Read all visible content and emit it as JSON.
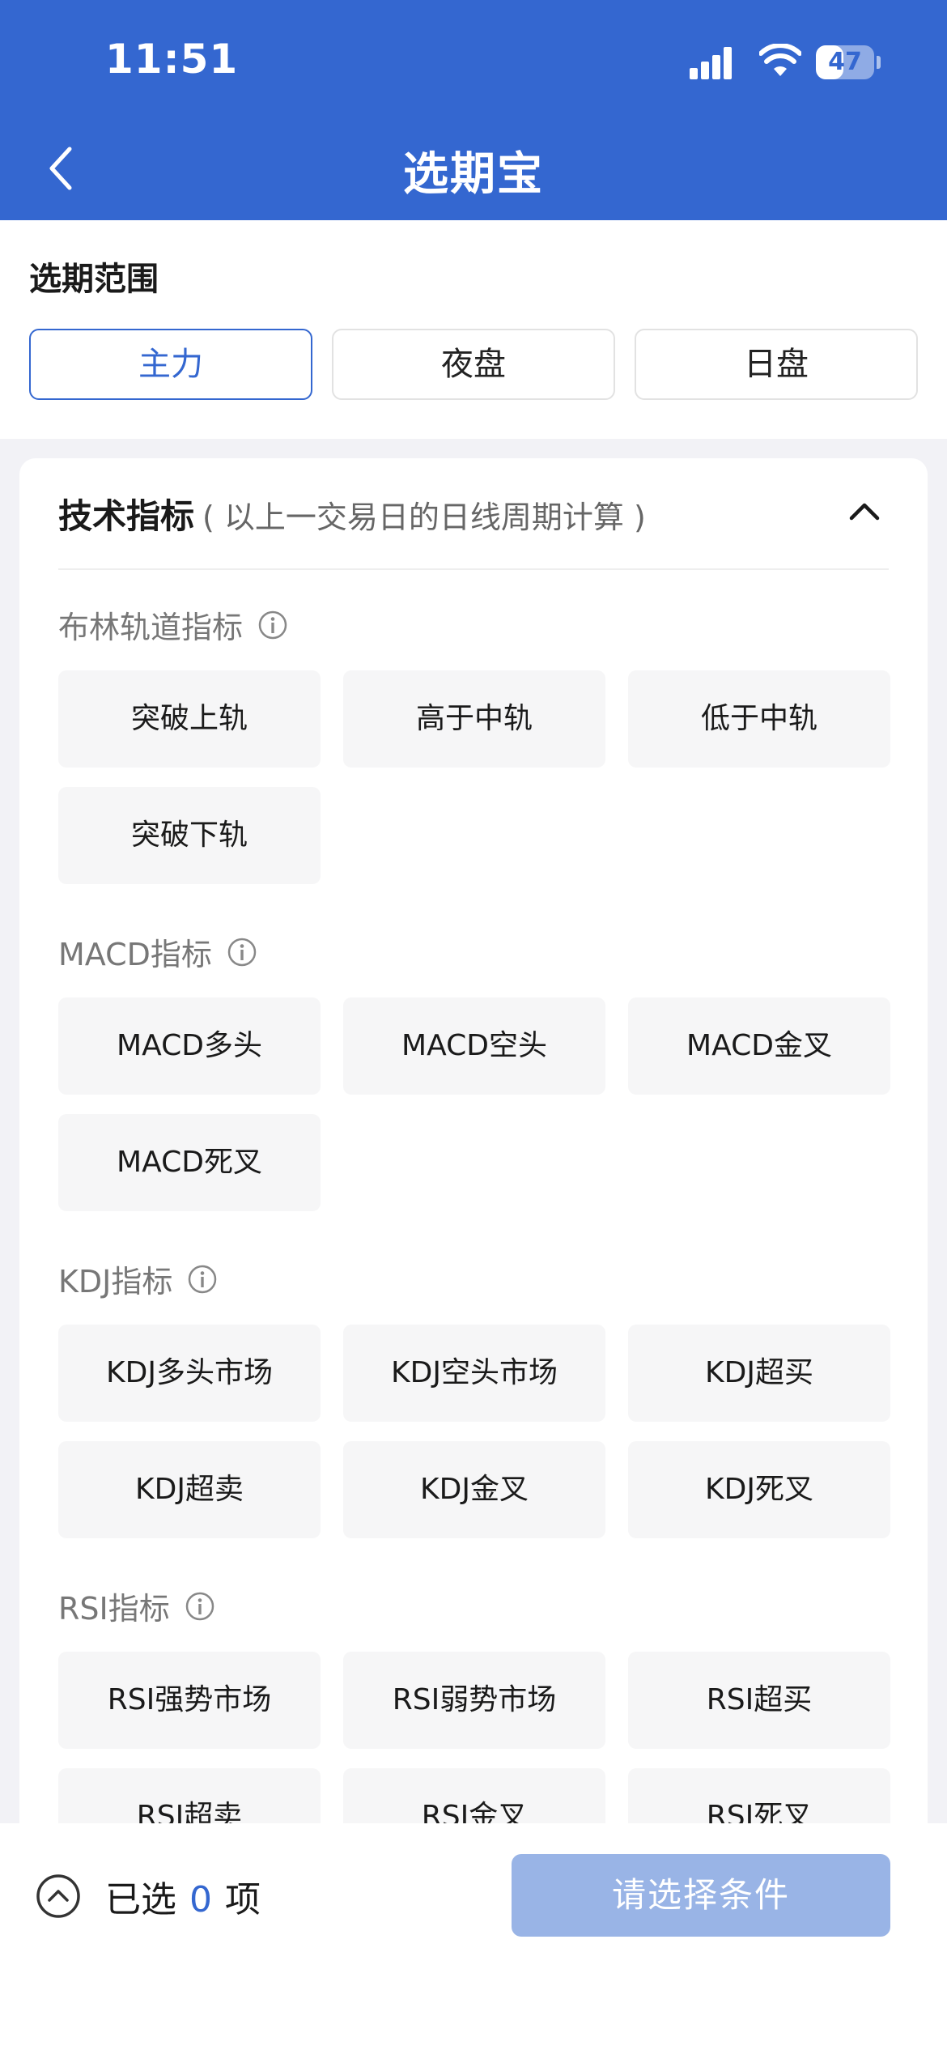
{
  "status_bar": {
    "time": "11:51",
    "battery": "47",
    "battery_level": 0.47
  },
  "nav": {
    "title": "选期宝"
  },
  "range": {
    "title": "选期范围",
    "options": [
      "主力",
      "夜盘",
      "日盘"
    ],
    "selected": "主力"
  },
  "tech": {
    "title": "技术指标",
    "subtitle": "( 以上一交易日的日线周期计算 )",
    "groups": [
      {
        "label": "布林轨道指标",
        "options": [
          "突破上轨",
          "高于中轨",
          "低于中轨",
          "突破下轨"
        ]
      },
      {
        "label": "MACD指标",
        "options": [
          "MACD多头",
          "MACD空头",
          "MACD金叉",
          "MACD死叉"
        ]
      },
      {
        "label": "KDJ指标",
        "options": [
          "KDJ多头市场",
          "KDJ空头市场",
          "KDJ超买",
          "KDJ超卖",
          "KDJ金叉",
          "KDJ死叉"
        ]
      },
      {
        "label": "RSI指标",
        "options": [
          "RSI强势市场",
          "RSI弱势市场",
          "RSI超买",
          "RSI超卖",
          "RSI金叉",
          "RSI死叉"
        ]
      }
    ]
  },
  "footer": {
    "selected_prefix": "已选",
    "selected_count": "0",
    "selected_suffix": "项",
    "submit_label": "请选择条件"
  },
  "colors": {
    "primary": "#3467d0",
    "submit_disabled": "#99b4e6"
  }
}
